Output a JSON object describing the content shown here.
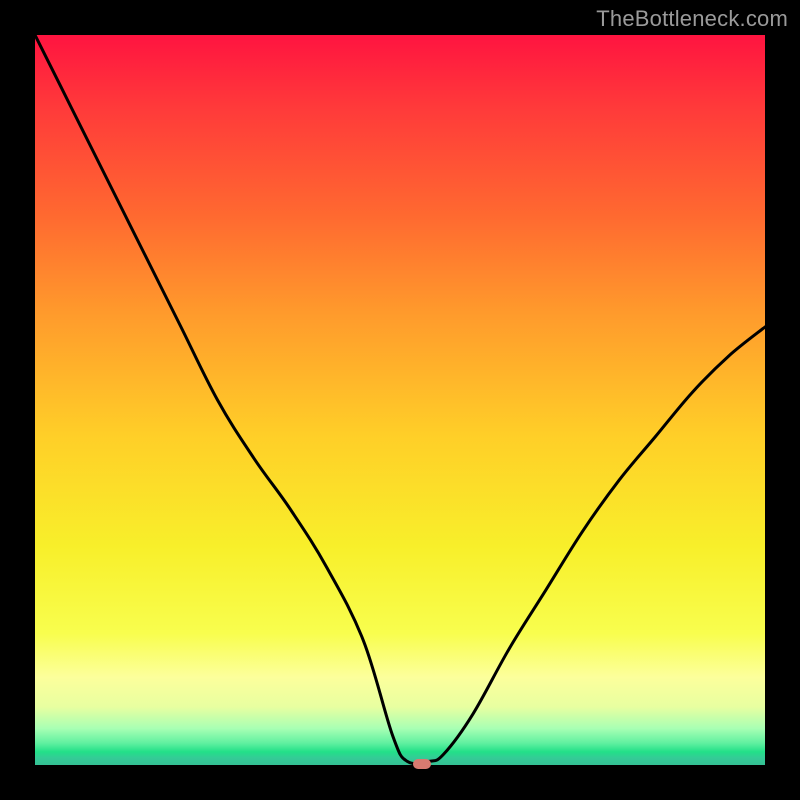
{
  "watermark": "TheBottleneck.com",
  "colors": {
    "marker": "#d77a70",
    "curve": "#000000",
    "frame": "#000000"
  },
  "chart_data": {
    "type": "line",
    "title": "",
    "xlabel": "",
    "ylabel": "",
    "xlim": [
      0,
      100
    ],
    "ylim": [
      0,
      100
    ],
    "grid": false,
    "legend": false,
    "annotations": [
      {
        "type": "marker",
        "x": 53,
        "y": 0.2,
        "style": "rounded-rect"
      }
    ],
    "series": [
      {
        "name": "bottleneck-curve",
        "x": [
          0,
          5,
          10,
          15,
          20,
          25,
          30,
          35,
          40,
          45,
          49,
          51,
          54,
          56,
          60,
          65,
          70,
          75,
          80,
          85,
          90,
          95,
          100
        ],
        "values": [
          100,
          90,
          80,
          70,
          60,
          50,
          42,
          35,
          27,
          17,
          4,
          0.5,
          0.5,
          1.5,
          7,
          16,
          24,
          32,
          39,
          45,
          51,
          56,
          60
        ]
      }
    ],
    "background_gradient": {
      "type": "vertical",
      "stops": [
        {
          "pos": 0.0,
          "color": "#ff1440"
        },
        {
          "pos": 0.1,
          "color": "#ff3a3a"
        },
        {
          "pos": 0.25,
          "color": "#ff6a30"
        },
        {
          "pos": 0.38,
          "color": "#ff9a2c"
        },
        {
          "pos": 0.55,
          "color": "#ffcf28"
        },
        {
          "pos": 0.7,
          "color": "#f8ef2a"
        },
        {
          "pos": 0.82,
          "color": "#f8fe4e"
        },
        {
          "pos": 0.88,
          "color": "#fcff9c"
        },
        {
          "pos": 0.92,
          "color": "#e8ffa0"
        },
        {
          "pos": 0.95,
          "color": "#a8ffb4"
        },
        {
          "pos": 0.97,
          "color": "#60f0a0"
        },
        {
          "pos": 0.982,
          "color": "#22e088"
        },
        {
          "pos": 0.99,
          "color": "#34cc96"
        },
        {
          "pos": 1.0,
          "color": "#34c094"
        }
      ]
    }
  }
}
